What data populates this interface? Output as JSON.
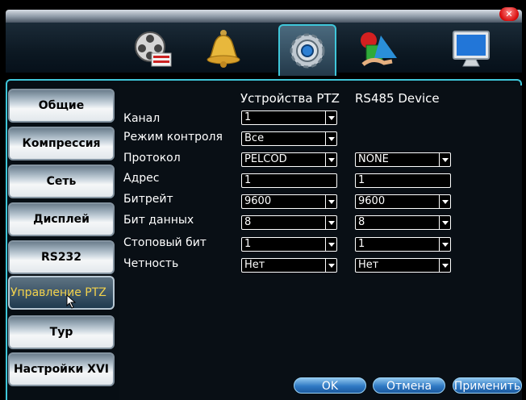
{
  "window": {
    "close_icon": "close-icon"
  },
  "toolbar_icons": [
    {
      "name": "record-icon"
    },
    {
      "name": "alarm-bell-icon"
    },
    {
      "name": "settings-gear-icon"
    },
    {
      "name": "tools-icon"
    },
    {
      "name": "monitor-icon"
    }
  ],
  "sidebar": {
    "items": [
      {
        "label": "Общие"
      },
      {
        "label": "Компрессия"
      },
      {
        "label": "Сеть"
      },
      {
        "label": "Дисплей"
      },
      {
        "label": "RS232"
      },
      {
        "label": "Управление PTZ"
      },
      {
        "label": "Тур"
      },
      {
        "label": "Настройки XVI"
      }
    ],
    "active_index": 5
  },
  "header": {
    "col1": "Устройства PTZ",
    "col2": "RS485 Device"
  },
  "rows": [
    {
      "label": "Канал",
      "ptz": "1",
      "rs485": ""
    },
    {
      "label": "Режим контроля",
      "ptz": "Все",
      "rs485": ""
    },
    {
      "label": "Протокол",
      "ptz": "PELCOD",
      "rs485": "NONE"
    },
    {
      "label": "Адрес",
      "ptz": "1",
      "rs485": "1"
    },
    {
      "label": "Битрейт",
      "ptz": "9600",
      "rs485": "9600"
    },
    {
      "label": "Бит данных",
      "ptz": "8",
      "rs485": "8"
    },
    {
      "label": "Стоповый бит",
      "ptz": "1",
      "rs485": "1"
    },
    {
      "label": "Четность",
      "ptz": "Нет",
      "rs485": "Нет"
    }
  ],
  "buttons": {
    "ok": "OK",
    "cancel": "Отмена",
    "apply": "Применить"
  },
  "colors": {
    "accent": "#3fc6d9",
    "active_text": "#f2d24c",
    "button_blue": "#2f79c4"
  }
}
